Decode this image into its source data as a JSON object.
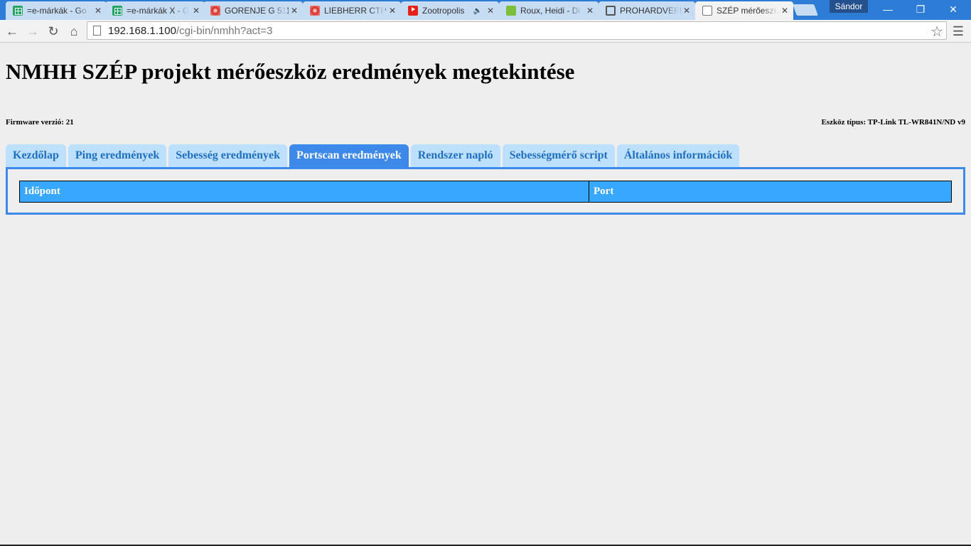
{
  "browser": {
    "tabs": [
      {
        "icon": "sheets-icon",
        "title": "=e-márkák - Go"
      },
      {
        "icon": "sheets-icon",
        "title": "=e-márkák X - G"
      },
      {
        "icon": "flower-icon",
        "title": "GORENJE G 511"
      },
      {
        "icon": "flower-icon",
        "title": "LIEBHERR CTP 2"
      },
      {
        "icon": "youtube-icon",
        "title": "Zootropolis"
      },
      {
        "icon": "green-square-icon",
        "title": "Roux, Heidi - Di"
      },
      {
        "icon": "search-icon",
        "title": "PROHARDVER!"
      },
      {
        "icon": "document-icon",
        "title": "SZÉP mérőeszk"
      }
    ],
    "profile_name": "Sándor",
    "url_host": "192.168.1.100",
    "url_path": "/cgi-bin/nmhh?act=3"
  },
  "page": {
    "title": "NMHH SZÉP projekt mérőeszköz eredmények megtekintése",
    "firmware": "Firmware verzió: 21",
    "device": "Eszköz típus: TP-Link TL-WR841N/ND v9",
    "nav_tabs": [
      "Kezdőlap",
      "Ping eredmények",
      "Sebesség eredmények",
      "Portscan eredmények",
      "Rendszer napló",
      "Sebességmérő script",
      "Általános információk"
    ],
    "active_tab": "Portscan eredmények",
    "table_headers": [
      "Időpont",
      "Port"
    ]
  },
  "colors": {
    "accent": "#3d89ea",
    "table_header": "#38a7ff",
    "tab_inactive": "#bee0ff"
  }
}
